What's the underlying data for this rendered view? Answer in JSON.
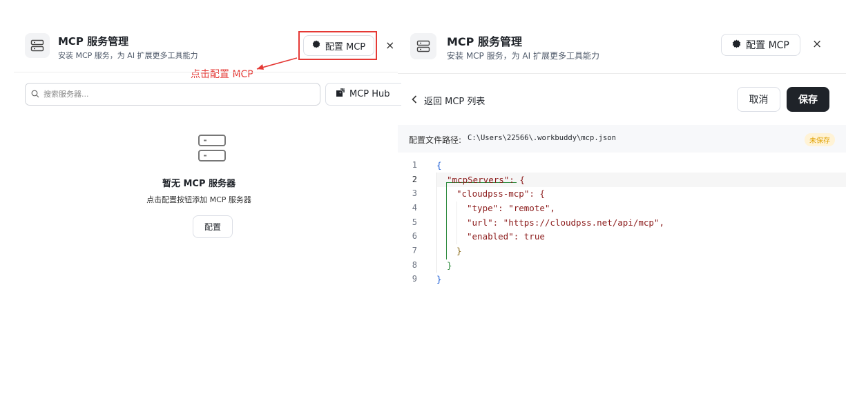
{
  "left_panel": {
    "title": "MCP 服务管理",
    "subtitle": "安装 MCP 服务，为 AI 扩展更多工具能力",
    "configure_button": "配置 MCP",
    "close": "×",
    "annotation": "点击配置 MCP",
    "search_placeholder": "搜索服务器...",
    "hub_button": "MCP Hub",
    "empty_title": "暂无 MCP 服务器",
    "empty_subtitle": "点击配置按钮添加 MCP 服务器",
    "empty_button": "配置"
  },
  "right_panel": {
    "title": "MCP 服务管理",
    "subtitle": "安装 MCP 服务，为 AI 扩展更多工具能力",
    "configure_button": "配置 MCP",
    "close": "×",
    "back_label": "返回 MCP 列表",
    "cancel_button": "取消",
    "save_button": "保存",
    "path_label": "配置文件路径:",
    "path_value": "C:\\Users\\22566\\.workbuddy\\mcp.json",
    "unsaved_badge": "未保存",
    "code_lines": [
      {
        "n": "1",
        "text": "{"
      },
      {
        "n": "2",
        "text": "\"mcpServers\": {"
      },
      {
        "n": "3",
        "text": "\"cloudpss-mcp\": {"
      },
      {
        "n": "4",
        "text": "\"type\": \"remote\","
      },
      {
        "n": "5",
        "text": "\"url\": \"https://cloudpss.net/api/mcp\","
      },
      {
        "n": "6",
        "text": "\"enabled\": true"
      },
      {
        "n": "7",
        "text": "}"
      },
      {
        "n": "8",
        "text": "}"
      },
      {
        "n": "9",
        "text": "}"
      }
    ],
    "active_line": "2"
  },
  "colors": {
    "highlight_red": "#e53935",
    "save_button_bg": "#1f2329",
    "badge_bg": "#fff3d6",
    "badge_text": "#e0a100"
  }
}
